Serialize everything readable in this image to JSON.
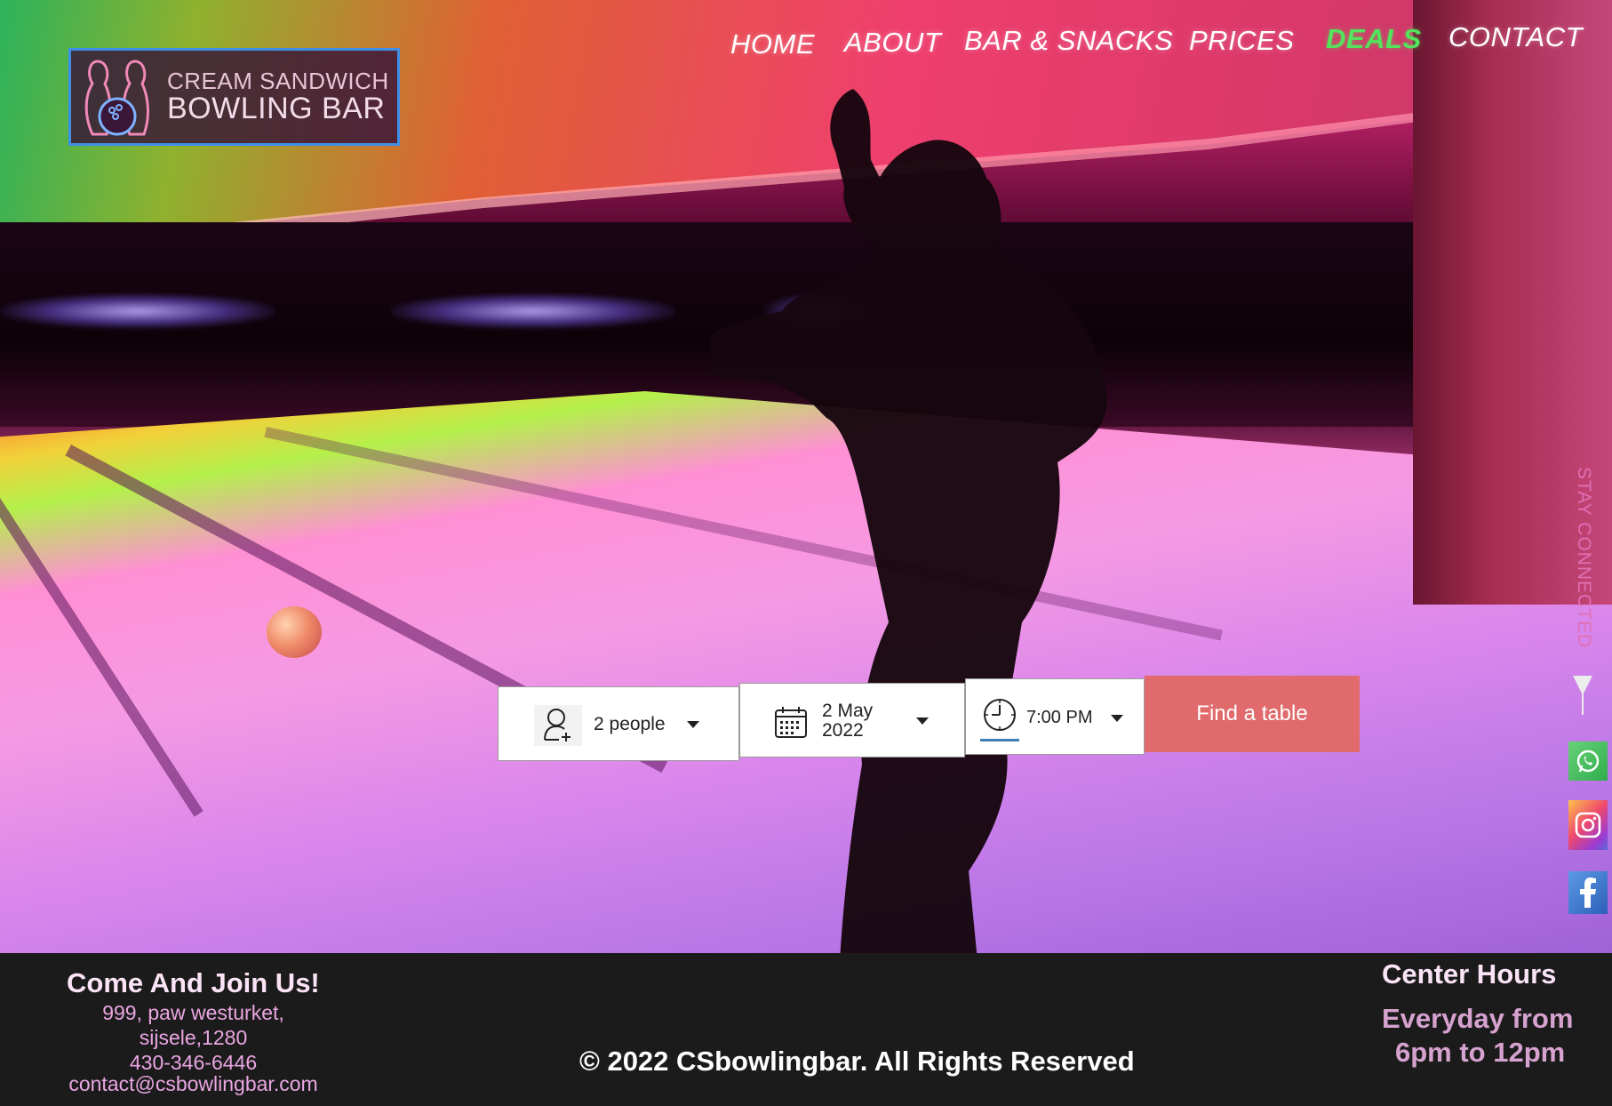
{
  "brand": {
    "line1": "CREAM SANDWICH",
    "line2": "BOWLING BAR"
  },
  "nav": {
    "items": [
      {
        "label": "HOME"
      },
      {
        "label": "ABOUT"
      },
      {
        "label": "BAR & SNACKS"
      },
      {
        "label": "PRICES"
      },
      {
        "label": "DEALS",
        "active": true
      },
      {
        "label": "CONTACT"
      }
    ],
    "active_color": "#53e35c"
  },
  "booking": {
    "people": "2 people",
    "date_line1": "2 May",
    "date_line2": "2022",
    "time": "7:00 PM",
    "submit_label": "Find a table",
    "submit_color": "#e06a6c",
    "icons": [
      "add-user-icon",
      "calendar-icon",
      "clock-icon",
      "caret-down-icon"
    ]
  },
  "social": {
    "label": "STAY CONNECTED",
    "items": [
      {
        "name": "whatsapp-icon"
      },
      {
        "name": "instagram-icon"
      },
      {
        "name": "facebook-icon"
      }
    ]
  },
  "footer": {
    "join_title": "Come And Join Us!",
    "address_line1": "999,  paw westurket,",
    "address_line2": "sijsele,1280",
    "phone": "430-346-6446",
    "email": "contact@csbowlingbar.com",
    "copyright": "© 2022 CSbowlingbar. All Rights Reserved",
    "hours_title": "Center Hours",
    "hours_line1": "Everyday from",
    "hours_line2": "6pm to 12pm"
  }
}
